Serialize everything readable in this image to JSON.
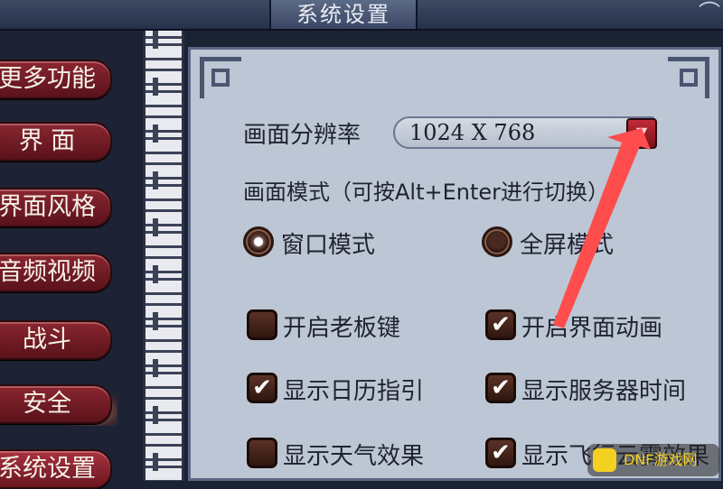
{
  "window": {
    "title": "系统设置",
    "close_glyph": "⌒"
  },
  "nav": {
    "items": [
      {
        "label": "更多功能"
      },
      {
        "label": "界 面"
      },
      {
        "label": "界面风格"
      },
      {
        "label": "音频视频"
      },
      {
        "label": "战斗"
      },
      {
        "label": "安全"
      },
      {
        "label": "系统设置"
      }
    ]
  },
  "settings": {
    "resolution_label": "画面分辨率",
    "resolution_value": "1024 X 768",
    "mode_label": "画面模式（可按Alt+Enter进行切换）",
    "radios": [
      {
        "label": "窗口模式",
        "selected": true
      },
      {
        "label": "全屏模式",
        "selected": false
      }
    ],
    "checkboxes": [
      {
        "label": "开启老板键",
        "checked": false
      },
      {
        "label": "开启界面动画",
        "checked": true
      },
      {
        "label": "显示日历指引",
        "checked": true
      },
      {
        "label": "显示服务器时间",
        "checked": true
      },
      {
        "label": "显示天气效果",
        "checked": false
      },
      {
        "label": "显示飞行云雾效果",
        "checked": true
      }
    ]
  },
  "watermark": {
    "text": "DNF游戏网"
  },
  "colors": {
    "accent_red": "#8a2630",
    "panel_bg": "#bdc6d4",
    "annotation_arrow": "#ff4d4d"
  }
}
